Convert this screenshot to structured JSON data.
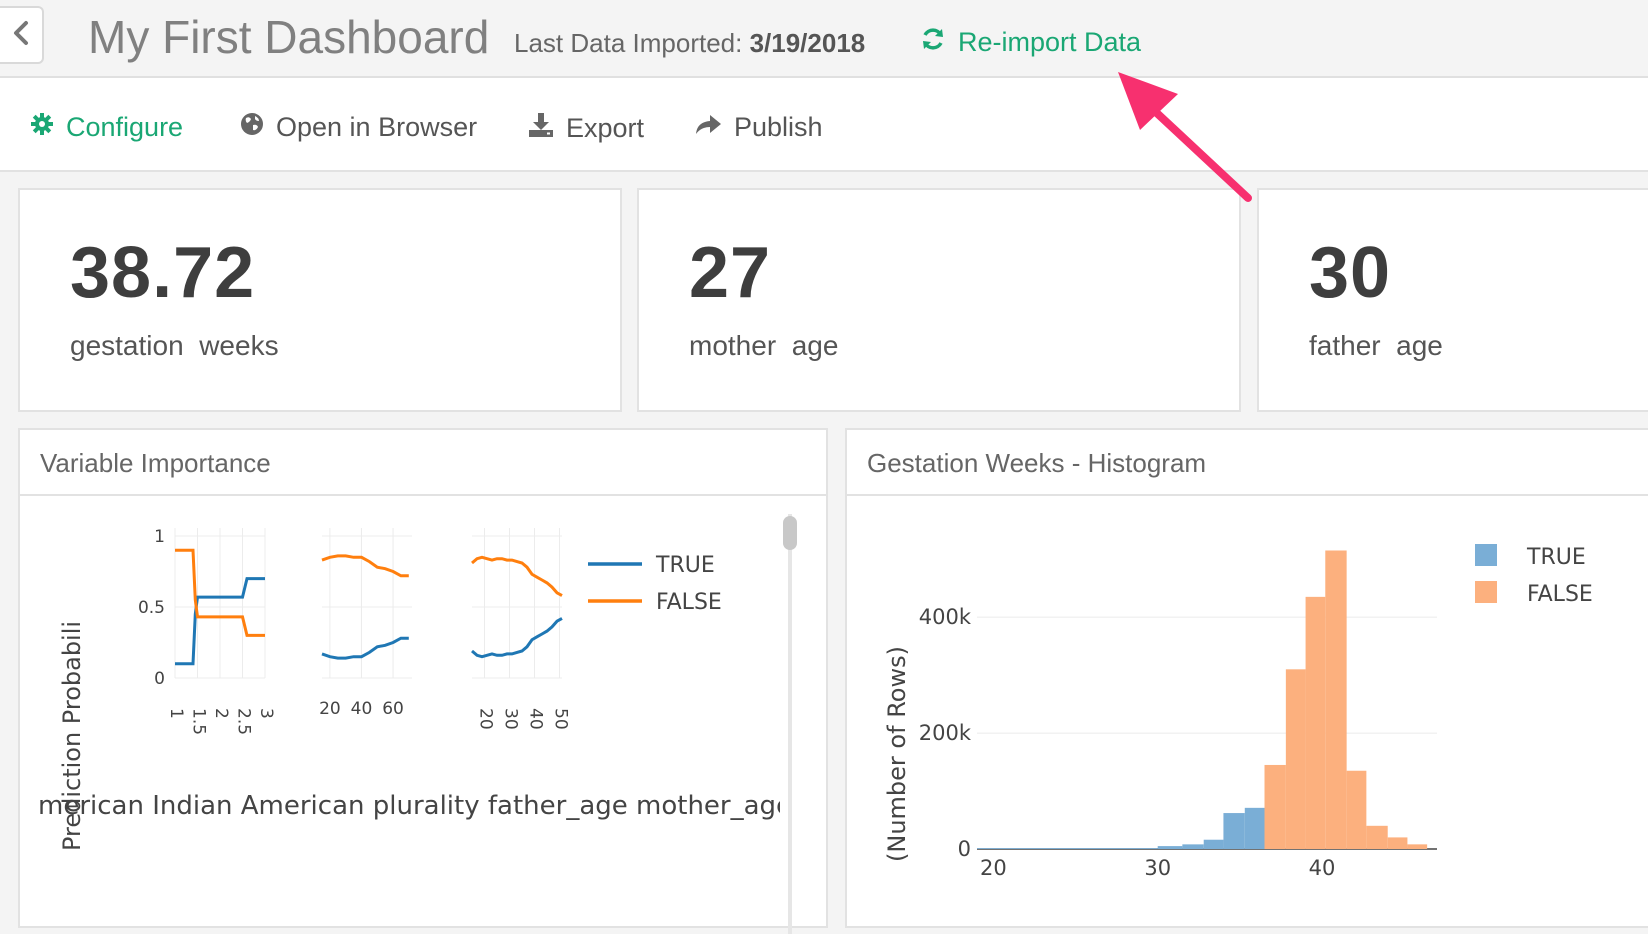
{
  "header": {
    "title": "My First Dashboard",
    "last_import_label": "Last Data Imported:",
    "last_import_date": "3/19/2018",
    "reimport_label": "Re-import Data"
  },
  "toolbar": {
    "configure": "Configure",
    "open_browser": "Open in Browser",
    "export": "Export",
    "publish": "Publish"
  },
  "kpis": [
    {
      "value": "38.72",
      "label": "gestation  weeks"
    },
    {
      "value": "27",
      "label": "mother  age"
    },
    {
      "value": "30",
      "label": "father  age"
    }
  ],
  "panels": {
    "variable_importance": {
      "title": "Variable Importance"
    },
    "histogram": {
      "title": "Gestation Weeks - Histogram"
    }
  },
  "colors": {
    "accent": "#1aa774",
    "true_line": "#1f77b4",
    "false_line": "#ff7f0e",
    "true_bar": "#7aaed6",
    "false_bar": "#fcb07e",
    "arrow": "#f7306f"
  },
  "chart_data": [
    {
      "type": "line",
      "panel": "Variable Importance",
      "ylabel": "Prediction Probabili",
      "legend": [
        "TRUE",
        "FALSE"
      ],
      "legend_position": "top-right",
      "subplots": [
        {
          "x_ticks": [
            "1",
            "1.5",
            "2",
            "2.5",
            "3"
          ],
          "xlim": [
            1,
            3
          ],
          "ylim": [
            0,
            1
          ],
          "y_ticks": [
            "0",
            "0.5",
            "1"
          ],
          "series": [
            {
              "name": "TRUE",
              "x": [
                1,
                1.4,
                1.45,
                1.5,
                2.5,
                2.6,
                3
              ],
              "y": [
                0.1,
                0.1,
                0.45,
                0.57,
                0.57,
                0.7,
                0.7
              ]
            },
            {
              "name": "FALSE",
              "x": [
                1,
                1.4,
                1.45,
                1.5,
                2.5,
                2.6,
                3
              ],
              "y": [
                0.9,
                0.9,
                0.55,
                0.43,
                0.43,
                0.3,
                0.3
              ]
            }
          ]
        },
        {
          "x_ticks": [
            "20",
            "40",
            "60"
          ],
          "xlim": [
            15,
            72
          ],
          "ylim": [
            0,
            1
          ],
          "series": [
            {
              "name": "TRUE",
              "x": [
                15,
                20,
                25,
                30,
                35,
                40,
                45,
                50,
                55,
                60,
                65,
                70
              ],
              "y": [
                0.17,
                0.15,
                0.14,
                0.14,
                0.15,
                0.15,
                0.18,
                0.22,
                0.23,
                0.25,
                0.28,
                0.28
              ]
            },
            {
              "name": "FALSE",
              "x": [
                15,
                20,
                25,
                30,
                35,
                40,
                45,
                50,
                55,
                60,
                65,
                70
              ],
              "y": [
                0.83,
                0.85,
                0.86,
                0.86,
                0.85,
                0.85,
                0.82,
                0.78,
                0.77,
                0.75,
                0.72,
                0.72
              ]
            }
          ]
        },
        {
          "x_ticks": [
            "20",
            "30",
            "40",
            "50"
          ],
          "xlim": [
            15,
            51
          ],
          "ylim": [
            0,
            1
          ],
          "series": [
            {
              "name": "TRUE",
              "x": [
                15,
                17,
                19,
                21,
                23,
                25,
                27,
                29,
                31,
                33,
                35,
                37,
                39,
                41,
                43,
                45,
                47,
                49,
                51
              ],
              "y": [
                0.19,
                0.16,
                0.15,
                0.16,
                0.17,
                0.16,
                0.16,
                0.17,
                0.17,
                0.18,
                0.19,
                0.22,
                0.27,
                0.29,
                0.31,
                0.33,
                0.36,
                0.4,
                0.42
              ]
            },
            {
              "name": "FALSE",
              "x": [
                15,
                17,
                19,
                21,
                23,
                25,
                27,
                29,
                31,
                33,
                35,
                37,
                39,
                41,
                43,
                45,
                47,
                49,
                51
              ],
              "y": [
                0.81,
                0.84,
                0.85,
                0.84,
                0.83,
                0.84,
                0.84,
                0.83,
                0.83,
                0.82,
                0.81,
                0.78,
                0.73,
                0.71,
                0.69,
                0.67,
                0.64,
                0.6,
                0.58
              ]
            }
          ]
        }
      ],
      "x_labels_overlapping": "American Indian American plurality father_age mother_age"
    },
    {
      "type": "bar",
      "panel": "Gestation Weeks - Histogram",
      "ylabel": "(Number of Rows)",
      "x_ticks": [
        "20",
        "30",
        "40"
      ],
      "y_ticks": [
        "0",
        "200k",
        "400k"
      ],
      "xlim": [
        19,
        47
      ],
      "ylim": [
        0,
        540000
      ],
      "legend": [
        "TRUE",
        "FALSE"
      ],
      "legend_position": "top-right",
      "series": [
        {
          "name": "TRUE",
          "bins": [
            [
              19,
              30,
              1500
            ],
            [
              30,
              31.5,
              5000
            ],
            [
              31.5,
              32.8,
              8000
            ],
            [
              32.8,
              34,
              16000
            ],
            [
              34,
              35.3,
              62000
            ],
            [
              35.3,
              36.5,
              71000
            ]
          ]
        },
        {
          "name": "FALSE",
          "bins": [
            [
              36.5,
              37.8,
              145000
            ],
            [
              37.8,
              39,
              310000
            ],
            [
              39,
              40.2,
              435000
            ],
            [
              40.2,
              41.5,
              515000
            ],
            [
              41.5,
              42.7,
              135000
            ],
            [
              42.7,
              44,
              40000
            ],
            [
              44,
              45.2,
              20000
            ],
            [
              45.2,
              46.4,
              8000
            ]
          ]
        }
      ]
    }
  ]
}
